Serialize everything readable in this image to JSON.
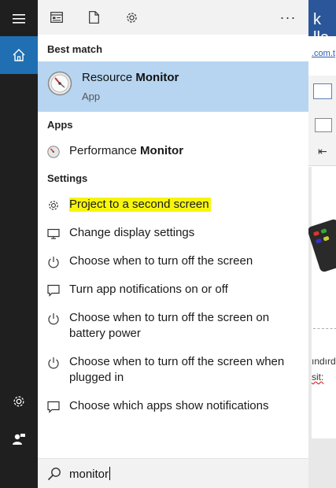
{
  "toolbar": {
    "more_label": "···"
  },
  "best_match": {
    "section_title": "Best match",
    "title_plain": "Resource ",
    "title_bold": "Monitor",
    "subtitle": "App"
  },
  "apps": {
    "section_title": "Apps",
    "items": [
      {
        "text_plain": "Performance ",
        "text_bold": "Monitor"
      }
    ]
  },
  "settings": {
    "section_title": "Settings",
    "items": [
      {
        "label": "Project to a second screen",
        "icon": "gear-icon"
      },
      {
        "label": "Change display settings",
        "icon": "display-icon"
      },
      {
        "label": "Choose when to turn off the screen",
        "icon": "power-icon"
      },
      {
        "label": "Turn app notifications on or off",
        "icon": "message-icon"
      },
      {
        "label": "Choose when to turn off the screen on battery power",
        "icon": "power-icon"
      },
      {
        "label": "Choose when to turn off the screen when plugged in",
        "icon": "power-icon"
      },
      {
        "label": "Choose which apps show notifications",
        "icon": "message-icon"
      }
    ]
  },
  "search": {
    "value": "monitor"
  },
  "background_window": {
    "title_fragment": "k lle",
    "link_fragment": ".com.t",
    "text_1": "ındırd",
    "text_2": "sit:"
  },
  "colors": {
    "rail": "#1f1f1f",
    "rail_selected": "#1f6fb2",
    "best_match_bg": "#b7d5f1",
    "highlight": "#f7f50d",
    "toolbar_bg": "#f2f2f2"
  }
}
